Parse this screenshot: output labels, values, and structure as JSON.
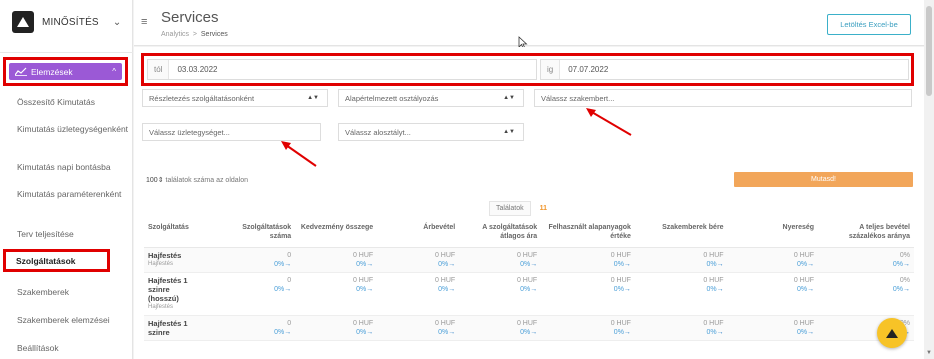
{
  "sidebar": {
    "brand": "MINŐSÍTÉS",
    "group_label": "Elemzések",
    "items": [
      {
        "label": "Összesítő Kimutatás"
      },
      {
        "label": "Kimutatás üzletegységenként"
      },
      {
        "label": "Kimutatás napi bontásba"
      },
      {
        "label": "Kimutatás paraméterenként"
      },
      {
        "label": "Terv teljesítése"
      },
      {
        "label": "Szolgáltatások"
      },
      {
        "label": "Szakemberek"
      },
      {
        "label": "Szakemberek elemzései"
      },
      {
        "label": "Beállítások"
      }
    ]
  },
  "header": {
    "title": "Services",
    "breadcrumb_root": "Analytics",
    "breadcrumb_sep": ">",
    "breadcrumb_current": "Services",
    "export_label": "Letöltés Excel-be"
  },
  "filters": {
    "from_prefix": "tól",
    "from_value": "03.03.2022",
    "to_prefix": "ig",
    "to_value": "07.07.2022",
    "detail_select": "Részletezés szolgáltatásonként",
    "class_select": "Alapértelmezett osztályozás",
    "specialist_placeholder": "Válassz szakembert...",
    "unit_placeholder": "Válassz üzletegységet...",
    "subclass_select": "Válassz alosztályt..."
  },
  "paging": {
    "per_page": "100",
    "per_page_label": "találatok száma az oldalon",
    "show_button": "Mutasd!"
  },
  "results": {
    "label": "Találatok",
    "count": "11"
  },
  "table": {
    "headers": [
      "Szolgáltatás",
      "Szolgáltatások száma",
      "Kedvezmény összege",
      "Árbevétel",
      "A szolgáltatások átlagos ára",
      "Felhasznált alapanyagok értéke",
      "Szakemberek bére",
      "Nyereség",
      "A teljes bevétel százalékos aránya"
    ],
    "rows": [
      {
        "name": "Hajfestés",
        "sub": "Hajfestés",
        "values": [
          "0",
          "0 HUF",
          "0 HUF",
          "0 HUF",
          "0 HUF",
          "0 HUF",
          "0 HUF",
          "0%"
        ],
        "pcts": [
          "0%",
          "0%",
          "0%",
          "0%",
          "0%",
          "0%",
          "0%",
          "0%"
        ]
      },
      {
        "name": "Hajfestés 1 szinre (hosszú)",
        "sub": "Hajfestés",
        "values": [
          "0",
          "0 HUF",
          "0 HUF",
          "0 HUF",
          "0 HUF",
          "0 HUF",
          "0 HUF",
          "0%"
        ],
        "pcts": [
          "0%",
          "0%",
          "0%",
          "0%",
          "0%",
          "0%",
          "0%",
          "0%"
        ]
      },
      {
        "name": "Hajfestés 1 szinre",
        "sub": "",
        "values": [
          "0",
          "0 HUF",
          "0 HUF",
          "0 HUF",
          "0 HUF",
          "0 HUF",
          "0 HUF",
          "0%"
        ],
        "pcts": [
          "0%",
          "0%",
          "0%",
          "0%",
          "0%",
          "0%",
          "0%",
          "0%"
        ]
      }
    ]
  }
}
